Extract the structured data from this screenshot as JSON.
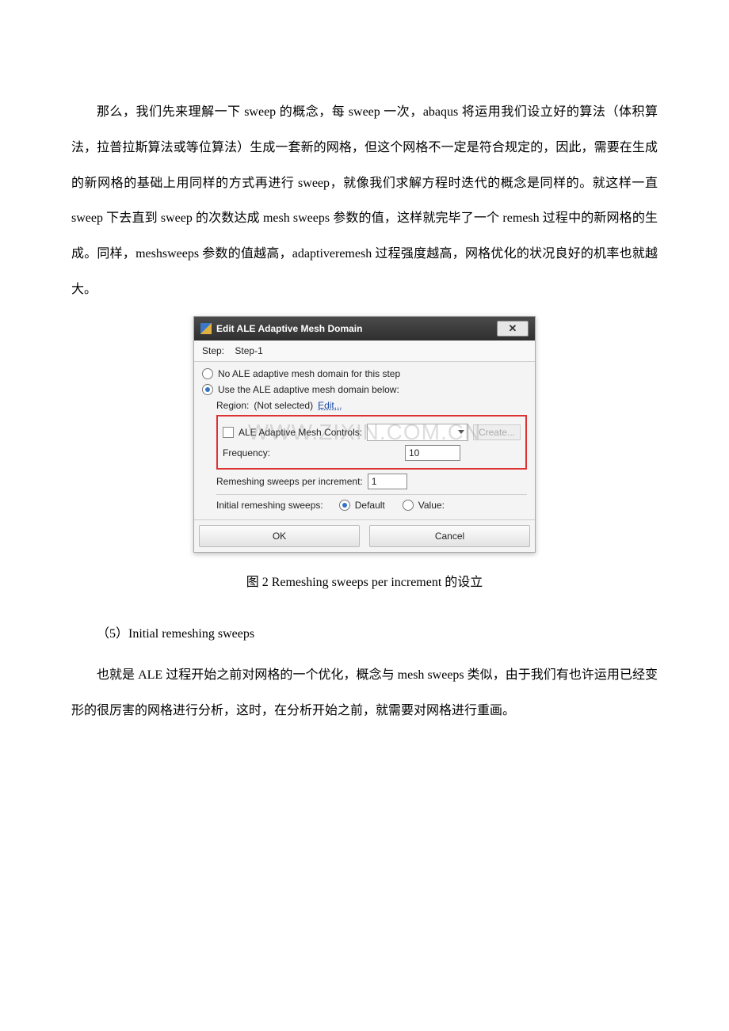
{
  "para1": "那么，我们先来理解一下 sweep 的概念，每 sweep 一次，abaqus 将运用我们设立好的算法（体积算法，拉普拉斯算法或等位算法）生成一套新的网格，但这个网格不一定是符合规定的，因此，需要在生成的新网格的基础上用同样的方式再进行 sweep，就像我们求解方程时迭代的概念是同样的。就这样一直 sweep 下去直到 sweep 的次数达成 mesh sweeps 参数的值，这样就完毕了一个 remesh 过程中的新网格的生成。同样，meshsweeps 参数的值越高，adaptiveremesh 过程强度越高，网格优化的状况良好的机率也就越大。",
  "caption": "图 2 Remeshing sweeps per increment 的设立",
  "section5": "（5）Initial remeshing sweeps",
  "para2": "也就是 ALE 过程开始之前对网格的一个优化，概念与 mesh sweeps 类似，由于我们有也许运用已经变形的很厉害的网格进行分析，这时，在分析开始之前，就需要对网格进行重画。",
  "dialog": {
    "title": "Edit ALE Adaptive Mesh Domain",
    "step_label": "Step:",
    "step_value": "Step-1",
    "radio_none": "No ALE adaptive mesh domain for this step",
    "radio_use": "Use the ALE adaptive mesh domain below:",
    "region_label": "Region:",
    "region_value": "(Not selected)",
    "edit": "Edit...",
    "controls_label": "ALE Adaptive Mesh Controls:",
    "create": "Create...",
    "frequency_label": "Frequency:",
    "frequency_value": "10",
    "remesh_label": "Remeshing sweeps per increment:",
    "remesh_value": "1",
    "initial_label": "Initial remeshing sweeps:",
    "default": "Default",
    "value": "Value:",
    "ok": "OK",
    "cancel": "Cancel"
  },
  "watermark": "WWW.ZIXIN.COM.CN"
}
